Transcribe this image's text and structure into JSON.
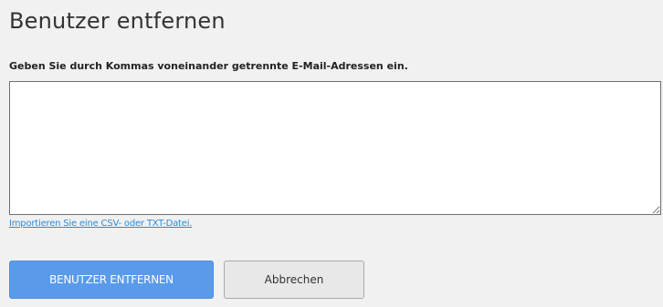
{
  "dialog": {
    "title": "Benutzer entfernen",
    "instruction": "Geben Sie durch Kommas voneinander getrennte E-Mail-Adressen ein.",
    "email_value": "",
    "import_link": "Importieren Sie eine CSV- oder TXT-Datei.",
    "remove_button": "BENUTZER ENTFERNEN",
    "cancel_button": "Abbrechen"
  },
  "colors": {
    "background": "#f1f1f1",
    "primary_button": "#5a9aeb",
    "link": "#2a8bd8"
  }
}
